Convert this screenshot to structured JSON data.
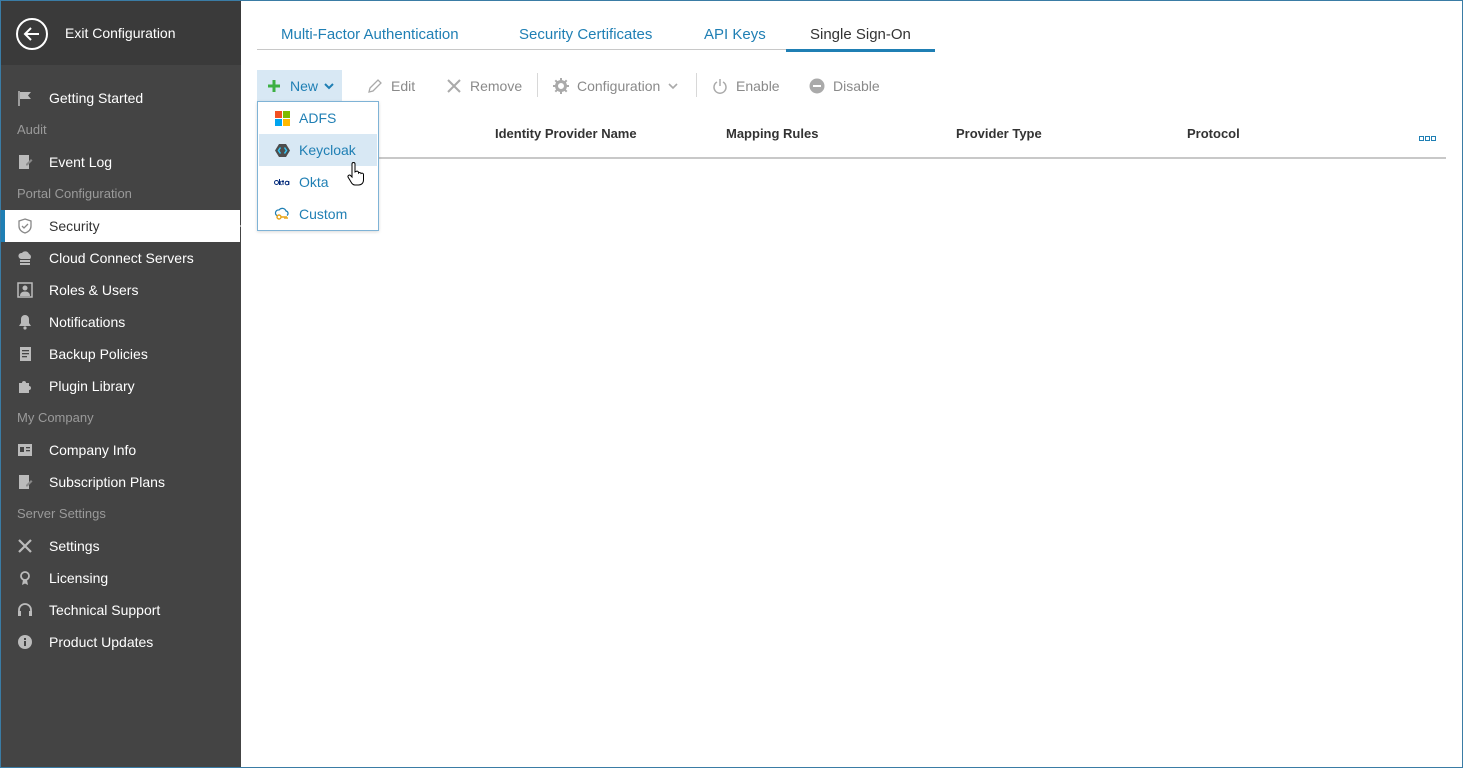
{
  "sidebar": {
    "exit_label": "Exit Configuration",
    "items": [
      {
        "label": "Getting Started",
        "icon": "flag-icon"
      },
      {
        "label": "Event Log",
        "icon": "event-log-icon"
      },
      {
        "label": "Security",
        "icon": "shield-icon",
        "active": true
      },
      {
        "label": "Cloud Connect Servers",
        "icon": "cloud-server-icon"
      },
      {
        "label": "Roles & Users",
        "icon": "user-card-icon"
      },
      {
        "label": "Notifications",
        "icon": "bell-icon"
      },
      {
        "label": "Backup Policies",
        "icon": "document-icon"
      },
      {
        "label": "Plugin Library",
        "icon": "puzzle-icon"
      },
      {
        "label": "Company Info",
        "icon": "company-card-icon"
      },
      {
        "label": "Subscription Plans",
        "icon": "edit-document-icon"
      },
      {
        "label": "Settings",
        "icon": "tools-icon"
      },
      {
        "label": "Licensing",
        "icon": "license-icon"
      },
      {
        "label": "Technical Support",
        "icon": "headset-icon"
      },
      {
        "label": "Product Updates",
        "icon": "info-icon"
      }
    ],
    "sections": {
      "audit": "Audit",
      "portal": "Portal Configuration",
      "company": "My Company",
      "server": "Server Settings"
    }
  },
  "tabs": [
    {
      "label": "Multi-Factor Authentication"
    },
    {
      "label": "Security Certificates"
    },
    {
      "label": "API Keys"
    },
    {
      "label": "Single Sign-On",
      "active": true
    }
  ],
  "toolbar": {
    "new": "New",
    "edit": "Edit",
    "remove": "Remove",
    "configuration": "Configuration",
    "enable": "Enable",
    "disable": "Disable"
  },
  "table": {
    "columns": [
      "Identity Provider Name",
      "Mapping Rules",
      "Provider Type",
      "Protocol"
    ]
  },
  "dropdown": {
    "items": [
      {
        "label": "ADFS",
        "icon": "windows-icon"
      },
      {
        "label": "Keycloak",
        "icon": "keycloak-icon",
        "hover": true
      },
      {
        "label": "Okta",
        "icon": "okta-icon"
      },
      {
        "label": "Custom",
        "icon": "custom-key-icon"
      }
    ]
  },
  "colors": {
    "accent": "#1f7fb4",
    "sidebar_bg": "#444444",
    "toolbar_active_bg": "#d8e8f4"
  }
}
